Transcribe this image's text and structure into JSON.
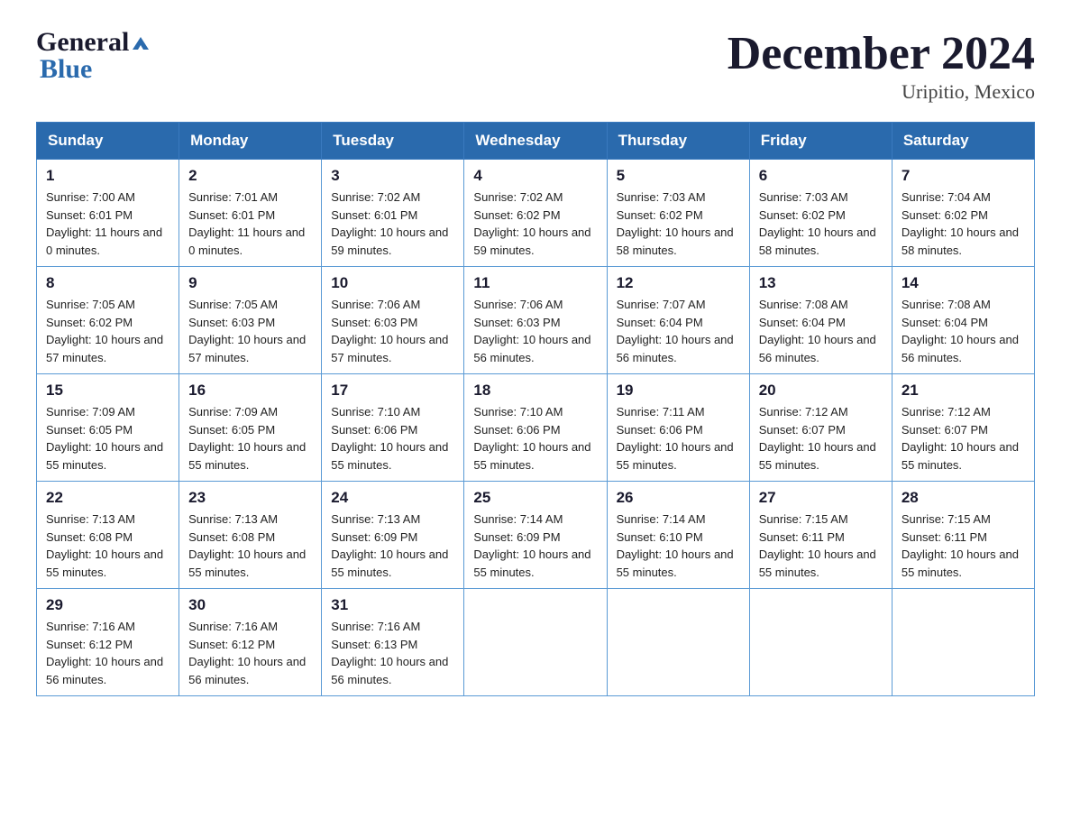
{
  "header": {
    "logo_general": "General",
    "logo_blue": "Blue",
    "month_title": "December 2024",
    "location": "Uripitio, Mexico"
  },
  "days_of_week": [
    "Sunday",
    "Monday",
    "Tuesday",
    "Wednesday",
    "Thursday",
    "Friday",
    "Saturday"
  ],
  "weeks": [
    [
      {
        "day": "1",
        "sunrise": "7:00 AM",
        "sunset": "6:01 PM",
        "daylight": "11 hours and 0 minutes."
      },
      {
        "day": "2",
        "sunrise": "7:01 AM",
        "sunset": "6:01 PM",
        "daylight": "11 hours and 0 minutes."
      },
      {
        "day": "3",
        "sunrise": "7:02 AM",
        "sunset": "6:01 PM",
        "daylight": "10 hours and 59 minutes."
      },
      {
        "day": "4",
        "sunrise": "7:02 AM",
        "sunset": "6:02 PM",
        "daylight": "10 hours and 59 minutes."
      },
      {
        "day": "5",
        "sunrise": "7:03 AM",
        "sunset": "6:02 PM",
        "daylight": "10 hours and 58 minutes."
      },
      {
        "day": "6",
        "sunrise": "7:03 AM",
        "sunset": "6:02 PM",
        "daylight": "10 hours and 58 minutes."
      },
      {
        "day": "7",
        "sunrise": "7:04 AM",
        "sunset": "6:02 PM",
        "daylight": "10 hours and 58 minutes."
      }
    ],
    [
      {
        "day": "8",
        "sunrise": "7:05 AM",
        "sunset": "6:02 PM",
        "daylight": "10 hours and 57 minutes."
      },
      {
        "day": "9",
        "sunrise": "7:05 AM",
        "sunset": "6:03 PM",
        "daylight": "10 hours and 57 minutes."
      },
      {
        "day": "10",
        "sunrise": "7:06 AM",
        "sunset": "6:03 PM",
        "daylight": "10 hours and 57 minutes."
      },
      {
        "day": "11",
        "sunrise": "7:06 AM",
        "sunset": "6:03 PM",
        "daylight": "10 hours and 56 minutes."
      },
      {
        "day": "12",
        "sunrise": "7:07 AM",
        "sunset": "6:04 PM",
        "daylight": "10 hours and 56 minutes."
      },
      {
        "day": "13",
        "sunrise": "7:08 AM",
        "sunset": "6:04 PM",
        "daylight": "10 hours and 56 minutes."
      },
      {
        "day": "14",
        "sunrise": "7:08 AM",
        "sunset": "6:04 PM",
        "daylight": "10 hours and 56 minutes."
      }
    ],
    [
      {
        "day": "15",
        "sunrise": "7:09 AM",
        "sunset": "6:05 PM",
        "daylight": "10 hours and 55 minutes."
      },
      {
        "day": "16",
        "sunrise": "7:09 AM",
        "sunset": "6:05 PM",
        "daylight": "10 hours and 55 minutes."
      },
      {
        "day": "17",
        "sunrise": "7:10 AM",
        "sunset": "6:06 PM",
        "daylight": "10 hours and 55 minutes."
      },
      {
        "day": "18",
        "sunrise": "7:10 AM",
        "sunset": "6:06 PM",
        "daylight": "10 hours and 55 minutes."
      },
      {
        "day": "19",
        "sunrise": "7:11 AM",
        "sunset": "6:06 PM",
        "daylight": "10 hours and 55 minutes."
      },
      {
        "day": "20",
        "sunrise": "7:12 AM",
        "sunset": "6:07 PM",
        "daylight": "10 hours and 55 minutes."
      },
      {
        "day": "21",
        "sunrise": "7:12 AM",
        "sunset": "6:07 PM",
        "daylight": "10 hours and 55 minutes."
      }
    ],
    [
      {
        "day": "22",
        "sunrise": "7:13 AM",
        "sunset": "6:08 PM",
        "daylight": "10 hours and 55 minutes."
      },
      {
        "day": "23",
        "sunrise": "7:13 AM",
        "sunset": "6:08 PM",
        "daylight": "10 hours and 55 minutes."
      },
      {
        "day": "24",
        "sunrise": "7:13 AM",
        "sunset": "6:09 PM",
        "daylight": "10 hours and 55 minutes."
      },
      {
        "day": "25",
        "sunrise": "7:14 AM",
        "sunset": "6:09 PM",
        "daylight": "10 hours and 55 minutes."
      },
      {
        "day": "26",
        "sunrise": "7:14 AM",
        "sunset": "6:10 PM",
        "daylight": "10 hours and 55 minutes."
      },
      {
        "day": "27",
        "sunrise": "7:15 AM",
        "sunset": "6:11 PM",
        "daylight": "10 hours and 55 minutes."
      },
      {
        "day": "28",
        "sunrise": "7:15 AM",
        "sunset": "6:11 PM",
        "daylight": "10 hours and 55 minutes."
      }
    ],
    [
      {
        "day": "29",
        "sunrise": "7:16 AM",
        "sunset": "6:12 PM",
        "daylight": "10 hours and 56 minutes."
      },
      {
        "day": "30",
        "sunrise": "7:16 AM",
        "sunset": "6:12 PM",
        "daylight": "10 hours and 56 minutes."
      },
      {
        "day": "31",
        "sunrise": "7:16 AM",
        "sunset": "6:13 PM",
        "daylight": "10 hours and 56 minutes."
      },
      null,
      null,
      null,
      null
    ]
  ]
}
